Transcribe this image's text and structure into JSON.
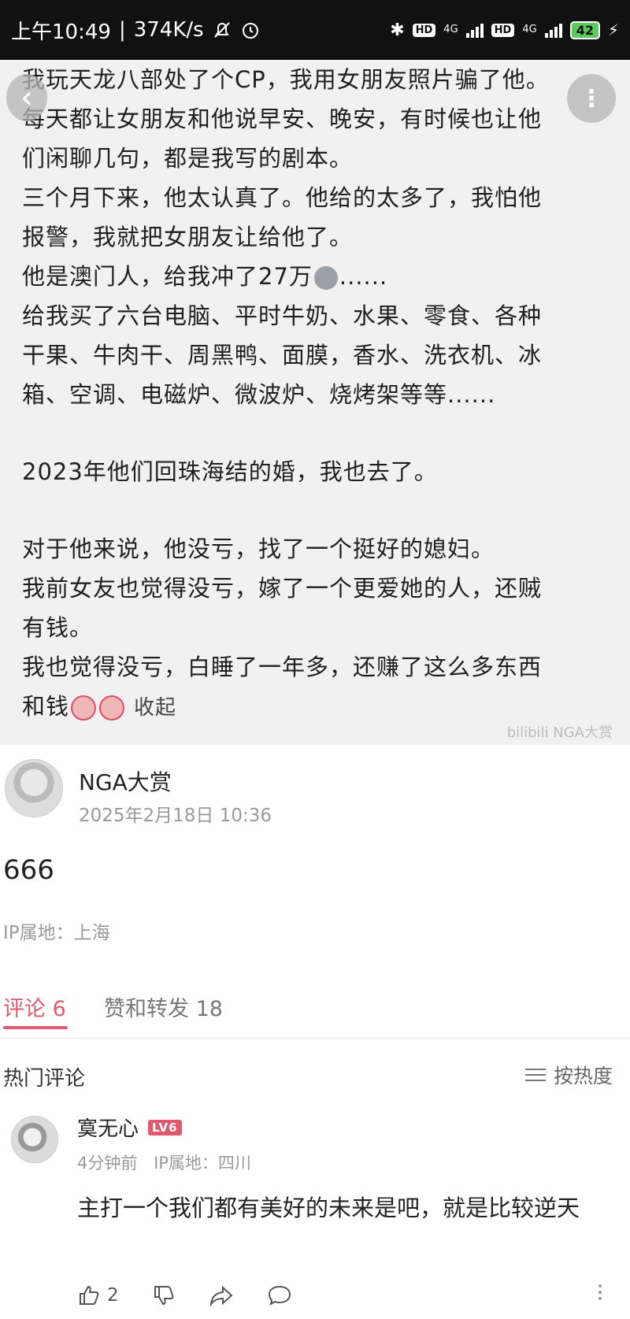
{
  "status_bar": {
    "time": "上午10:49",
    "speed": "374K/s",
    "network_1": "4G",
    "network_2": "4G",
    "hd_1": "HD",
    "hd_2": "HD",
    "battery": "42"
  },
  "post_image": {
    "lines": [
      "我玩天龙八部处了个CP，我用女朋友照片骗了他。",
      "每天都让女朋友和他说早安、晚安，有时候也让他",
      "们闲聊几句，都是我写的剧本。",
      "三个月下来，他太认真了。他给的太多了，我怕他",
      "报警，我就把女朋友让给他了。",
      "他是澳门人，给我冲了27万",
      "给我买了六台电脑、平时牛奶、水果、零食、各种",
      "干果、牛肉干、周黑鸭、面膜，香水、洗衣机、冰",
      "箱、空调、电磁炉、微波炉、烧烤架等等......",
      "2023年他们回珠海结的婚，我也去了。",
      "对于他来说，他没亏，找了一个挺好的媳妇。",
      "我前女友也觉得没亏，嫁了一个更爱她的人，还贼",
      "有钱。",
      "我也觉得没亏，白睡了一年多，还赚了这么多东西",
      "和钱"
    ],
    "line6_suffix": "......",
    "collapse_label": "收起",
    "watermark": "bilibili NGA大赏"
  },
  "author": {
    "name": "NGA大赏",
    "time": "2025年2月18日 10:36"
  },
  "post": {
    "body": "666",
    "ip": "IP属地：上海"
  },
  "tabs": {
    "comments": "评论 6",
    "likes": "赞和转发 18"
  },
  "hot": {
    "title": "热门评论",
    "sort": "按热度"
  },
  "comment": {
    "user": "寞无心",
    "level": "LV6",
    "time": "4分钟前",
    "ip": "IP属地：四川",
    "text": "主打一个我们都有美好的未来是吧，就是比较逆天",
    "likes": "2"
  },
  "colors": {
    "accent": "#e05a6f",
    "status_bar": "#111111"
  }
}
